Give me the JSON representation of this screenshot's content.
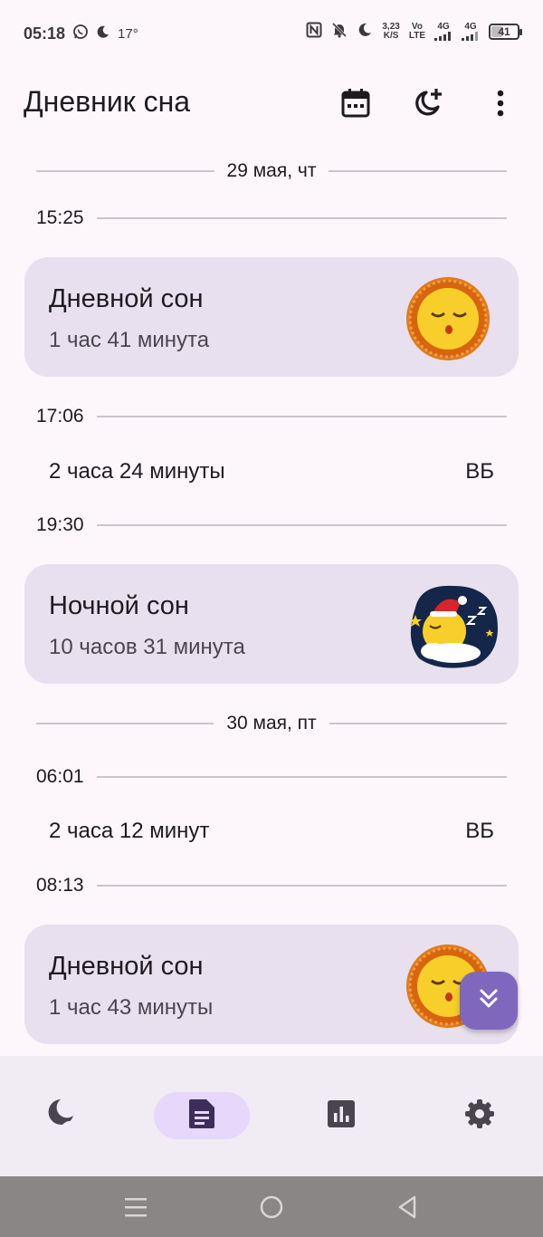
{
  "status_bar": {
    "time": "05:18",
    "temperature": "17°",
    "net_speed_value": "3,23",
    "net_speed_unit": "K/S",
    "volte_top": "Vo",
    "volte_bottom": "LTE",
    "net1": "4G",
    "net2": "4G",
    "battery": "41",
    "battery_level": 0.41
  },
  "app_bar": {
    "title": "Дневник сна",
    "icons": [
      "calendar-icon",
      "add-sleep-icon",
      "more-vert-icon"
    ]
  },
  "timeline": {
    "date1": "29 мая, чт",
    "time1": "15:25",
    "card1": {
      "title": "Дневной сон",
      "duration": "1 час 41 минута",
      "image": "sun-sleeping"
    },
    "time2": "17:06",
    "awake1": {
      "duration": "2 часа 24 минуты",
      "tag": "ВБ"
    },
    "time3": "19:30",
    "card2": {
      "title": "Ночной сон",
      "duration": "10 часов 31 минута",
      "image": "moon-sleeping"
    },
    "date2": "30 мая, пт",
    "time4": "06:01",
    "awake2": {
      "duration": "2 часа 12 минут",
      "tag": "ВБ"
    },
    "time5": "08:13",
    "card3": {
      "title": "Дневной сон",
      "duration": "1 час 43 минуты",
      "image": "sun-sleeping"
    }
  },
  "bottom_nav": {
    "items": [
      "sleep-icon",
      "diary-icon",
      "stats-icon",
      "settings-icon"
    ],
    "active": "diary-icon"
  },
  "colors": {
    "background": "#fdf7fc",
    "card": "#e8e0ee",
    "accent": "#7f67be",
    "nav_active": "#e6d7fb"
  }
}
